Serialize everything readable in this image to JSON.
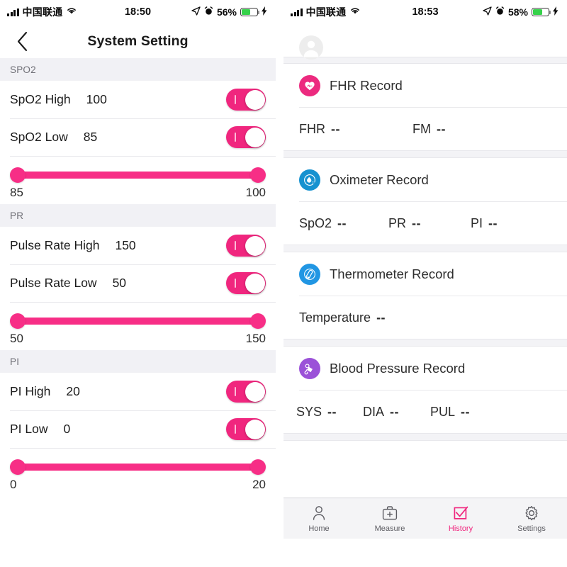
{
  "left_screen": {
    "status_bar": {
      "carrier": "中国联通",
      "time": "18:50",
      "battery_percent": "56%",
      "icons": [
        "signal-bars-icon",
        "wifi-icon",
        "location-arrow-icon",
        "alarm-clock-icon",
        "battery-icon",
        "charging-bolt-icon"
      ]
    },
    "nav": {
      "back_icon": "chevron-left-icon",
      "title": "System Setting"
    },
    "sections": [
      {
        "header": "SPO2",
        "rows": [
          {
            "label": "SpO2 High",
            "value": "100",
            "toggle_on": true
          },
          {
            "label": "SpO2 Low",
            "value": "85",
            "toggle_on": true
          }
        ],
        "slider": {
          "min_label": "85",
          "max_label": "100"
        }
      },
      {
        "header": "PR",
        "rows": [
          {
            "label": "Pulse Rate High",
            "value": "150",
            "toggle_on": true
          },
          {
            "label": "Pulse Rate Low",
            "value": "50",
            "toggle_on": true
          }
        ],
        "slider": {
          "min_label": "50",
          "max_label": "150"
        }
      },
      {
        "header": "PI",
        "rows": [
          {
            "label": "PI High",
            "value": "20",
            "toggle_on": true
          },
          {
            "label": "PI Low",
            "value": "0",
            "toggle_on": true
          }
        ],
        "slider": {
          "min_label": "0",
          "max_label": "20"
        }
      }
    ]
  },
  "right_screen": {
    "status_bar": {
      "carrier": "中国联通",
      "time": "18:53",
      "battery_percent": "58%"
    },
    "avatar": "user-avatar-icon",
    "records": [
      {
        "icon": "heart-icon",
        "icon_color": "#ec2a7f",
        "title": "FHR Record",
        "values": [
          {
            "label": "FHR",
            "value": "--"
          },
          {
            "label": "FM",
            "value": "--"
          }
        ]
      },
      {
        "icon": "oximeter-drop-icon",
        "icon_color": "#1692d0",
        "title": "Oximeter Record",
        "values": [
          {
            "label": "SpO2",
            "value": "--"
          },
          {
            "label": "PR",
            "value": "--"
          },
          {
            "label": "PI",
            "value": "--"
          }
        ]
      },
      {
        "icon": "thermometer-icon",
        "icon_color": "#2196e3",
        "title": "Thermometer Record",
        "values": [
          {
            "label": "Temperature",
            "value": "--"
          }
        ]
      },
      {
        "icon": "blood-pressure-cuff-icon",
        "icon_color": "#9b51d8",
        "title": "Blood Pressure Record",
        "values": [
          {
            "label": "SYS",
            "value": "--"
          },
          {
            "label": "DIA",
            "value": "--"
          },
          {
            "label": "PUL",
            "value": "--"
          }
        ]
      }
    ],
    "tabs": [
      {
        "label": "Home",
        "icon": "person-icon",
        "active": false
      },
      {
        "label": "Measure",
        "icon": "briefcase-plus-icon",
        "active": false
      },
      {
        "label": "History",
        "icon": "checkbox-check-icon",
        "active": true
      },
      {
        "label": "Settings",
        "icon": "gear-icon",
        "active": false
      }
    ]
  },
  "theme": {
    "accent_pink": "#f0267e",
    "slider_pink": "#f72e86",
    "section_gray": "#f1f1f5"
  }
}
